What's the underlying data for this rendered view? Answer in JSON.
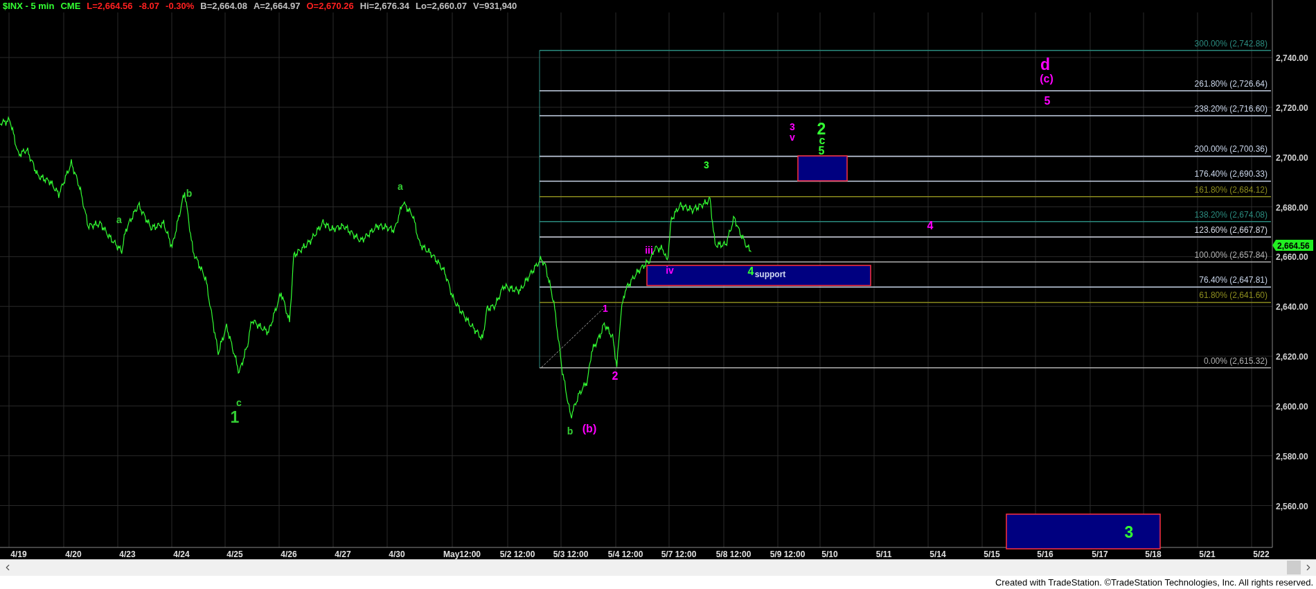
{
  "header": [
    {
      "text": "$INX - 5 min",
      "color": "#33ff33"
    },
    {
      "text": "CME",
      "color": "#33ff33"
    },
    {
      "text": "L=2,664.56",
      "color": "#ff2020"
    },
    {
      "text": "-8.07",
      "color": "#ff2020"
    },
    {
      "text": "-0.30%",
      "color": "#ff2020"
    },
    {
      "text": "B=2,664.08",
      "color": "#c0c0c0"
    },
    {
      "text": "A=2,664.97",
      "color": "#c0c0c0"
    },
    {
      "text": "O=2,670.26",
      "color": "#ff2020"
    },
    {
      "text": "Hi=2,676.34",
      "color": "#c0c0c0"
    },
    {
      "text": "Lo=2,660.07",
      "color": "#c0c0c0"
    },
    {
      "text": "V=931,940",
      "color": "#c0c0c0"
    }
  ],
  "fib_levels": [
    {
      "label": "300.00% (2,742.88)",
      "color": "#2a8a7e"
    },
    {
      "label": "261.80% (2,726.64)",
      "color": "#c8d4e8"
    },
    {
      "label": "238.20% (2,716.60)",
      "color": "#c8d4e8"
    },
    {
      "label": "200.00% (2,700.36)",
      "color": "#c8d4e8"
    },
    {
      "label": "176.40% (2,690.33)",
      "color": "#c8d4e8"
    },
    {
      "label": "161.80% (2,684.12)",
      "color": "#8c8c1e"
    },
    {
      "label": "138.20% (2,674.08)",
      "color": "#2a8a7e"
    },
    {
      "label": "123.60% (2,667.87)",
      "color": "#d8dce8"
    },
    {
      "label": "100.00% (2,657.84)",
      "color": "#b0b0b0"
    },
    {
      "label": "76.40% (2,647.81)",
      "color": "#c8d4e8"
    },
    {
      "label": "61.80% (2,641.60)",
      "color": "#8c8c1e"
    },
    {
      "label": "0.00% (2,615.32)",
      "color": "#b0b0b0"
    }
  ],
  "support_zone": {
    "label": "support"
  },
  "wave_labels": [
    {
      "text": "a",
      "color": "#33cc33",
      "kind": "minor"
    },
    {
      "text": "b",
      "color": "#33cc33",
      "kind": "minor"
    },
    {
      "text": "c",
      "color": "#33cc33",
      "kind": "minor"
    },
    {
      "text": "1",
      "color": "#33cc33",
      "kind": "major"
    },
    {
      "text": "a",
      "color": "#33cc33",
      "kind": "minor"
    },
    {
      "text": "b",
      "color": "#33cc33",
      "kind": "minor"
    },
    {
      "text": "(b)",
      "color": "#ff00ff",
      "kind": "medium"
    },
    {
      "text": "1",
      "color": "#ff00ff",
      "kind": "minor"
    },
    {
      "text": "2",
      "color": "#ff00ff",
      "kind": "medium"
    },
    {
      "text": "iii",
      "color": "#ff00ff",
      "kind": "minor"
    },
    {
      "text": "iv",
      "color": "#ff00ff",
      "kind": "minor"
    },
    {
      "text": "3",
      "color": "#33ff33",
      "kind": "minor"
    },
    {
      "text": "4",
      "color": "#33ff33",
      "kind": "medium"
    },
    {
      "text": "3",
      "color": "#ff00ff",
      "kind": "minor"
    },
    {
      "text": "v",
      "color": "#ff00ff",
      "kind": "minor"
    },
    {
      "text": "2",
      "color": "#33ff33",
      "kind": "major"
    },
    {
      "text": "c",
      "color": "#33ff33",
      "kind": "medium"
    },
    {
      "text": "5",
      "color": "#33ff33",
      "kind": "medium"
    },
    {
      "text": "4",
      "color": "#ff00ff",
      "kind": "medium"
    },
    {
      "text": "d",
      "color": "#ff00ff",
      "kind": "major"
    },
    {
      "text": "(c)",
      "color": "#ff00ff",
      "kind": "medium"
    },
    {
      "text": "5",
      "color": "#ff00ff",
      "kind": "medium"
    },
    {
      "text": "3",
      "color": "#33ff33",
      "kind": "major"
    }
  ],
  "price_axis": [
    "2,740.00",
    "2,720.00",
    "2,700.00",
    "2,680.00",
    "2,660.00",
    "2,640.00",
    "2,620.00",
    "2,600.00",
    "2,580.00",
    "2,560.00"
  ],
  "last_price": "2,664.56",
  "date_axis": [
    "4/19",
    "4/20",
    "4/23",
    "4/24",
    "4/25",
    "4/26",
    "4/27",
    "4/30",
    "May12:00",
    "5/2 12:00",
    "5/3 12:00",
    "5/4 12:00",
    "5/7 12:00",
    "5/8 12:00",
    "5/9 12:00",
    "5/10",
    "5/11",
    "5/14",
    "5/15",
    "5/16",
    "5/17",
    "5/18",
    "5/21",
    "5/22"
  ],
  "footer": "Created with TradeStation. ©TradeStation Technologies, Inc. All rights reserved."
}
